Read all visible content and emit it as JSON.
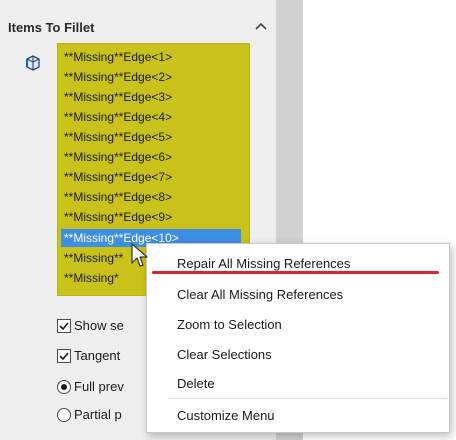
{
  "panel": {
    "title": "Items To Fillet",
    "items": [
      "**Missing**Edge<1>",
      "**Missing**Edge<2>",
      "**Missing**Edge<3>",
      "**Missing**Edge<4>",
      "**Missing**Edge<5>",
      "**Missing**Edge<6>",
      "**Missing**Edge<7>",
      "**Missing**Edge<8>",
      "**Missing**Edge<9>",
      "**Missing**Edge<10>",
      "**Missing**",
      "**Missing*"
    ],
    "selected_index": 9,
    "list_color": "#c9c21a",
    "options": {
      "show_selection": "Show se",
      "tangent": "Tangent",
      "full_preview": "Full prev",
      "partial_preview": "Partial p"
    }
  },
  "context_menu": {
    "items": [
      "Repair All Missing References",
      "Clear All Missing References",
      "Zoom to Selection",
      "Clear Selections",
      "Delete",
      "Customize Menu"
    ],
    "annotation_color": "#d8262b"
  },
  "icons": {
    "collapse": "chevron-up-icon",
    "edge": "edge-icon",
    "cursor": "mouse-pointer-icon"
  }
}
